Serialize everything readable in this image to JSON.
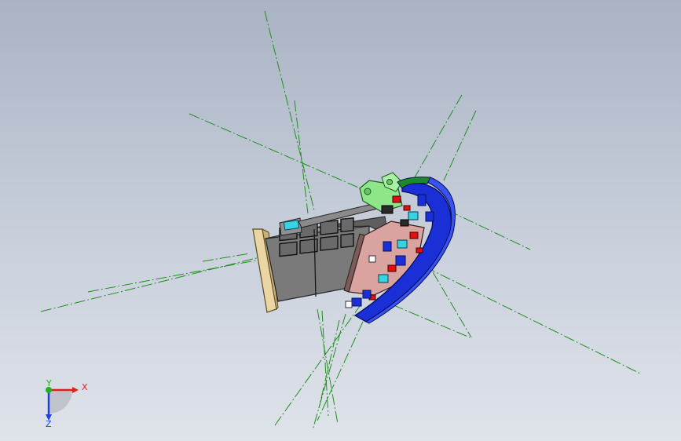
{
  "viewport": {
    "background_top": "#a9b3c3",
    "background_bottom": "#dfe3ea",
    "construction_line_color": "#1f8f1f"
  },
  "model": {
    "colors": {
      "housing_gray": "#6f6f6f",
      "flange_tan": "#e9d6a4",
      "cover_blue": "#1a2fd6",
      "bracket_green": "#8ee58a",
      "board_pink": "#d9a3a0",
      "accent_red": "#e01010",
      "accent_cyan": "#36d3e0"
    }
  },
  "triad": {
    "x_label": "X",
    "y_label": "Y",
    "z_label": "Z",
    "x_color": "#e02020",
    "y_color": "#20b020",
    "z_color": "#2040e0"
  }
}
